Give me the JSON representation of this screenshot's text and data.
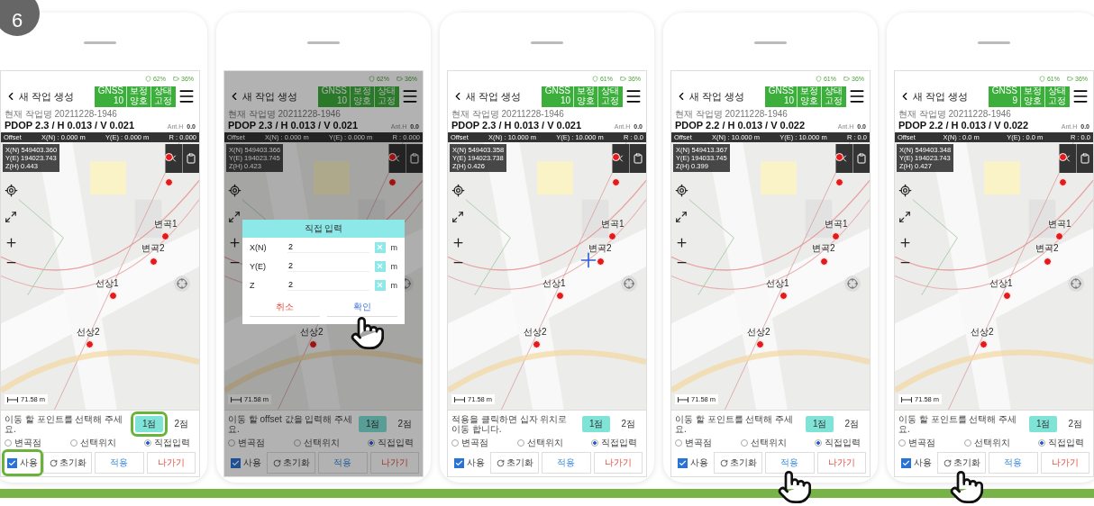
{
  "step": "6",
  "phones": [
    {
      "status": {
        "signal": "62%",
        "battery": "36%"
      },
      "title": "새 작업 생성",
      "gnss": [
        {
          "label": "GNSS",
          "value": "10"
        },
        {
          "label": "보정",
          "value": "양호"
        },
        {
          "label": "상태",
          "value": "고정"
        }
      ],
      "job": "현재 작업명 20211228-1946",
      "dop": "PDOP 2.3 / H 0.013 / V 0.021",
      "ant": {
        "label": "Ant.H",
        "value": "0.0"
      },
      "offset": [
        "Offset",
        "X(N) : 0.000 m",
        "Y(E) : 0.000 m",
        "R : 0.000"
      ],
      "coords": [
        "X(N) 549403.360",
        "Y(E) 194023.743",
        "Z(H) 0.443"
      ],
      "map_labels": [
        "선상2",
        "선상1",
        "변곡2",
        "변곡1"
      ],
      "scale": "71.58 m",
      "crosshair": false,
      "dimmed": false,
      "message": "이동 할 포인트를 선택해 주세요.",
      "points": [
        {
          "label": "1점",
          "selected": true,
          "highlighted": true
        },
        {
          "label": "2점",
          "selected": false,
          "highlighted": false
        }
      ],
      "modes": [
        {
          "label": "변곡점",
          "selected": false
        },
        {
          "label": "선택위치",
          "selected": false
        },
        {
          "label": "직접입력",
          "selected": true
        }
      ],
      "use": {
        "label": "사용",
        "checked": true,
        "highlighted": true
      },
      "actions": [
        {
          "label": "초기화",
          "kind": "reset",
          "tapped": false
        },
        {
          "label": "적용",
          "kind": "apply",
          "tapped": false
        },
        {
          "label": "나가기",
          "kind": "exit",
          "tapped": false
        }
      ]
    },
    {
      "status": {
        "signal": "62%",
        "battery": "36%"
      },
      "title": "새 작업 생성",
      "gnss": [
        {
          "label": "GNSS",
          "value": "10"
        },
        {
          "label": "보정",
          "value": "양호"
        },
        {
          "label": "상태",
          "value": "고정"
        }
      ],
      "job": "현재 작업명 20211228-1946",
      "dop": "PDOP 2.3 / H 0.013 / V 0.021",
      "ant": {
        "label": "Ant.H",
        "value": "0.0"
      },
      "offset": [
        "Offset",
        "X(N) : 0.000 m",
        "Y(E) : 0.000 m",
        "R : 0.000"
      ],
      "coords": [
        "X(N) 549403.366",
        "Y(E) 194023.745",
        "Z(H) 0.423"
      ],
      "map_labels": [
        "선상2"
      ],
      "scale": "71.58 m",
      "crosshair": false,
      "dimmed": true,
      "message": "이동 할 offset 값을 입력해 주세요.",
      "points": [
        {
          "label": "1점",
          "selected": true,
          "highlighted": false
        },
        {
          "label": "2점",
          "selected": false,
          "highlighted": false
        }
      ],
      "modes": [
        {
          "label": "변곡점",
          "selected": false
        },
        {
          "label": "선택위치",
          "selected": false
        },
        {
          "label": "직접입력",
          "selected": true
        }
      ],
      "use": {
        "label": "사용",
        "checked": true,
        "highlighted": false
      },
      "actions": [
        {
          "label": "초기화",
          "kind": "reset",
          "tapped": false
        },
        {
          "label": "적용",
          "kind": "apply",
          "tapped": false
        },
        {
          "label": "나가기",
          "kind": "exit",
          "tapped": false
        }
      ],
      "dialog": {
        "title": "직접 입력",
        "fields": [
          {
            "label": "X(N)",
            "value": "2",
            "unit": "m"
          },
          {
            "label": "Y(E)",
            "value": "2",
            "unit": "m"
          },
          {
            "label": "Z",
            "value": "2",
            "unit": "m"
          }
        ],
        "actions": [
          {
            "label": "취소",
            "kind": "cancel",
            "tapped": false
          },
          {
            "label": "확인",
            "kind": "confirm",
            "tapped": true
          }
        ]
      }
    },
    {
      "status": {
        "signal": "61%",
        "battery": "36%"
      },
      "title": "새 작업 생성",
      "gnss": [
        {
          "label": "GNSS",
          "value": "10"
        },
        {
          "label": "보정",
          "value": "양호"
        },
        {
          "label": "상태",
          "value": "고정"
        }
      ],
      "job": "현재 작업명 20211228-1946",
      "dop": "PDOP 2.3 / H 0.013 / V 0.021",
      "ant": {
        "label": "Ant.H",
        "value": "0.0"
      },
      "offset": [
        "Offset",
        "X(N) : 10.000 m",
        "Y(E) : 10.000 m",
        "R : 0.0"
      ],
      "coords": [
        "X(N) 549403.358",
        "Y(E) 194023.738",
        "Z(H) 0.426"
      ],
      "map_labels": [
        "선상2",
        "선상1",
        "변곡2",
        "변곡1"
      ],
      "scale": "71.58 m",
      "crosshair": true,
      "dimmed": false,
      "message": "적용을 클릭하면 십자 위치로 이동 합니다.",
      "points": [
        {
          "label": "1점",
          "selected": true,
          "highlighted": false
        },
        {
          "label": "2점",
          "selected": false,
          "highlighted": false
        }
      ],
      "modes": [
        {
          "label": "변곡점",
          "selected": false
        },
        {
          "label": "선택위치",
          "selected": false
        },
        {
          "label": "직접입력",
          "selected": true
        }
      ],
      "use": {
        "label": "사용",
        "checked": true,
        "highlighted": false
      },
      "actions": [
        {
          "label": "초기화",
          "kind": "reset",
          "tapped": false
        },
        {
          "label": "적용",
          "kind": "apply",
          "tapped": false
        },
        {
          "label": "나가기",
          "kind": "exit",
          "tapped": false
        }
      ]
    },
    {
      "status": {
        "signal": "61%",
        "battery": "36%"
      },
      "title": "새 작업 생성",
      "gnss": [
        {
          "label": "GNSS",
          "value": "10"
        },
        {
          "label": "보정",
          "value": "양호"
        },
        {
          "label": "상태",
          "value": "고정"
        }
      ],
      "job": "현재 작업명 20211228-1946",
      "dop": "PDOP 2.2 / H 0.013 / V 0.022",
      "ant": {
        "label": "Ant.H",
        "value": "0.0"
      },
      "offset": [
        "Offset",
        "X(N) : 10.000 m",
        "Y(E) : 10.000 m",
        "R : 0.0"
      ],
      "coords": [
        "X(N) 549413.367",
        "Y(E) 194033.745",
        "Z(H) 0.399"
      ],
      "map_labels": [
        "선상2",
        "선상1",
        "변곡2",
        "변곡1"
      ],
      "scale": "71.58 m",
      "crosshair": false,
      "dimmed": false,
      "message": "이동 할 포인트를 선택해 주세요.",
      "points": [
        {
          "label": "1점",
          "selected": true,
          "highlighted": false
        },
        {
          "label": "2점",
          "selected": false,
          "highlighted": false
        }
      ],
      "modes": [
        {
          "label": "변곡점",
          "selected": false
        },
        {
          "label": "선택위치",
          "selected": false
        },
        {
          "label": "직접입력",
          "selected": true
        }
      ],
      "use": {
        "label": "사용",
        "checked": true,
        "highlighted": false
      },
      "actions": [
        {
          "label": "초기화",
          "kind": "reset",
          "tapped": false
        },
        {
          "label": "적용",
          "kind": "apply",
          "tapped": true
        },
        {
          "label": "나가기",
          "kind": "exit",
          "tapped": false
        }
      ]
    },
    {
      "status": {
        "signal": "61%",
        "battery": "36%"
      },
      "title": "새 작업 생성",
      "gnss": [
        {
          "label": "GNSS",
          "value": "9"
        },
        {
          "label": "보정",
          "value": "양호"
        },
        {
          "label": "상태",
          "value": "고정"
        }
      ],
      "job": "현재 작업명 20211228-1946",
      "dop": "PDOP 2.2 / H 0.013 / V 0.022",
      "ant": {
        "label": "Ant.H",
        "value": "0.0"
      },
      "offset": [
        "Offset",
        "X(N) : 0.0 m",
        "Y(E) : 0.0 m",
        "R : 0.0"
      ],
      "coords": [
        "X(N) 549403.348",
        "Y(E) 194023.743",
        "Z(H) 0.427"
      ],
      "map_labels": [
        "선상2",
        "선상1",
        "변곡2",
        "변곡1"
      ],
      "scale": "71.58 m",
      "crosshair": false,
      "dimmed": false,
      "message": "이동 할 포인트를 선택해 주세요.",
      "points": [
        {
          "label": "1점",
          "selected": true,
          "highlighted": false
        },
        {
          "label": "2점",
          "selected": false,
          "highlighted": false
        }
      ],
      "modes": [
        {
          "label": "변곡점",
          "selected": false
        },
        {
          "label": "선택위치",
          "selected": false
        },
        {
          "label": "직접입력",
          "selected": true
        }
      ],
      "use": {
        "label": "사용",
        "checked": true,
        "highlighted": false
      },
      "actions": [
        {
          "label": "초기화",
          "kind": "reset",
          "tapped": true
        },
        {
          "label": "적용",
          "kind": "apply",
          "tapped": false
        },
        {
          "label": "나가기",
          "kind": "exit",
          "tapped": false
        }
      ]
    }
  ]
}
